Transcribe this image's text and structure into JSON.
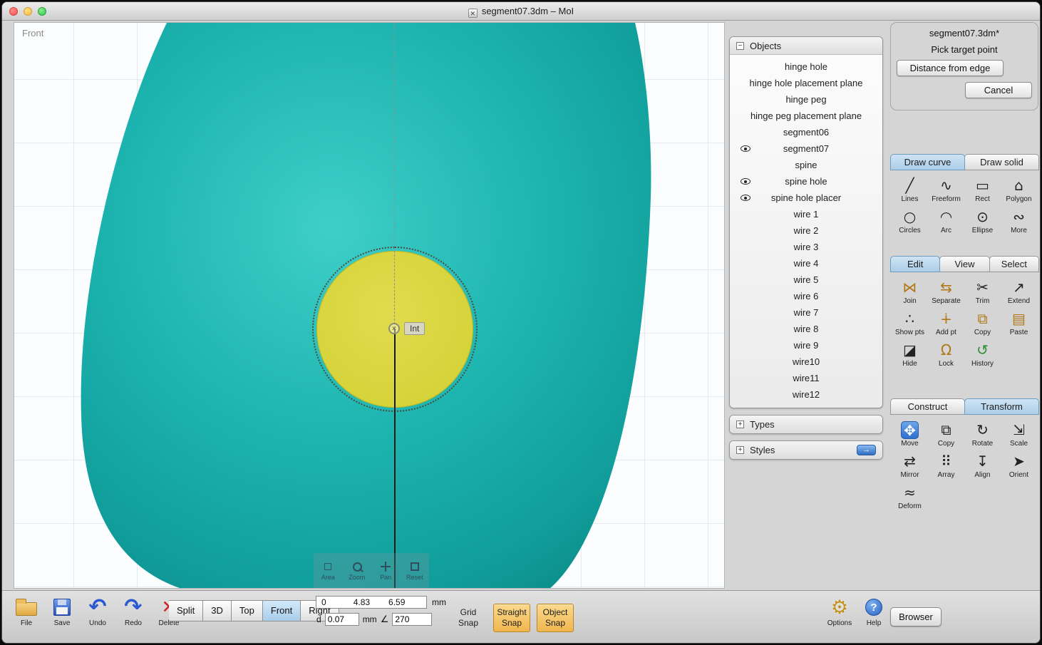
{
  "window": {
    "title": "segment07.3dm – MoI"
  },
  "viewport": {
    "view_label": "Front",
    "snap_tooltip": "Int",
    "object_color": "#1cb3ae",
    "selection_color": "#d5d13a",
    "controls": [
      {
        "name": "area-zoom-button",
        "label": "Area",
        "icon": "area-icon"
      },
      {
        "name": "zoom-button",
        "label": "Zoom",
        "icon": "zoom-icon"
      },
      {
        "name": "pan-button",
        "label": "Pan",
        "icon": "pan-icon"
      },
      {
        "name": "reset-view-button",
        "label": "Reset",
        "icon": "reset-icon"
      }
    ]
  },
  "scene": {
    "objects": {
      "title": "Objects",
      "collapse_symbol": "−",
      "items": [
        {
          "label": "hinge hole",
          "visible_eye": false
        },
        {
          "label": "hinge hole placement plane",
          "visible_eye": false
        },
        {
          "label": "hinge peg",
          "visible_eye": false
        },
        {
          "label": "hinge peg placement plane",
          "visible_eye": false
        },
        {
          "label": "segment06",
          "visible_eye": false
        },
        {
          "label": "segment07",
          "visible_eye": true
        },
        {
          "label": "spine",
          "visible_eye": false
        },
        {
          "label": "spine hole",
          "visible_eye": true
        },
        {
          "label": "spine hole placer",
          "visible_eye": true
        },
        {
          "label": "wire 1",
          "visible_eye": false
        },
        {
          "label": "wire 2",
          "visible_eye": false
        },
        {
          "label": "wire 3",
          "visible_eye": false
        },
        {
          "label": "wire 4",
          "visible_eye": false
        },
        {
          "label": "wire 5",
          "visible_eye": false
        },
        {
          "label": "wire 6",
          "visible_eye": false
        },
        {
          "label": "wire 7",
          "visible_eye": false
        },
        {
          "label": "wire 8",
          "visible_eye": false
        },
        {
          "label": "wire 9",
          "visible_eye": false
        },
        {
          "label": "wire10",
          "visible_eye": false
        },
        {
          "label": "wire11",
          "visible_eye": false
        },
        {
          "label": "wire12",
          "visible_eye": false
        }
      ]
    },
    "types": {
      "title": "Types",
      "collapse_symbol": "+"
    },
    "styles": {
      "title": "Styles",
      "collapse_symbol": "+"
    }
  },
  "command_panel": {
    "doc_title": "segment07.3dm*",
    "prompt": "Pick target point",
    "buttons": [
      {
        "label": "Distance from edge"
      },
      {
        "label": "Cancel"
      }
    ]
  },
  "draw_section": {
    "tabs": [
      {
        "name": "tab-draw-curve",
        "label": "Draw curve",
        "active": true
      },
      {
        "name": "tab-draw-solid",
        "label": "Draw solid",
        "active": false
      }
    ],
    "tools": [
      {
        "name": "tool-lines",
        "label": "Lines",
        "icon": "lines-icon",
        "glyph": "╱"
      },
      {
        "name": "tool-freeform",
        "label": "Freeform",
        "icon": "freeform-icon",
        "glyph": "∿"
      },
      {
        "name": "tool-rect",
        "label": "Rect",
        "icon": "rect-icon",
        "glyph": "▭"
      },
      {
        "name": "tool-polygon",
        "label": "Polygon",
        "icon": "polygon-icon",
        "glyph": "⌂"
      },
      {
        "name": "tool-circles",
        "label": "Circles",
        "icon": "circles-icon",
        "glyph": "○"
      },
      {
        "name": "tool-arc",
        "label": "Arc",
        "icon": "arc-icon",
        "glyph": "◠"
      },
      {
        "name": "tool-ellipse",
        "label": "Ellipse",
        "icon": "ellipse-icon",
        "glyph": "⊙"
      },
      {
        "name": "tool-more-curves",
        "label": "More",
        "icon": "more-curves-icon",
        "glyph": "∾"
      }
    ]
  },
  "edit_section": {
    "tabs": [
      {
        "name": "tab-edit",
        "label": "Edit",
        "active": true
      },
      {
        "name": "tab-view",
        "label": "View",
        "active": false
      },
      {
        "name": "tab-select",
        "label": "Select",
        "active": false
      }
    ],
    "tools": [
      {
        "name": "tool-join",
        "label": "Join",
        "icon": "join-icon",
        "glyph": "⋈",
        "color": "#b07818"
      },
      {
        "name": "tool-separate",
        "label": "Separate",
        "icon": "separate-icon",
        "glyph": "⇆",
        "color": "#b07818"
      },
      {
        "name": "tool-trim",
        "label": "Trim",
        "icon": "trim-icon",
        "glyph": "✂"
      },
      {
        "name": "tool-extend",
        "label": "Extend",
        "icon": "extend-icon",
        "glyph": "↗"
      },
      {
        "name": "tool-show-points",
        "label": "Show pts",
        "icon": "show-points-icon",
        "glyph": "∴"
      },
      {
        "name": "tool-add-point",
        "label": "Add pt",
        "icon": "add-point-icon",
        "glyph": "∔",
        "color": "#b07818"
      },
      {
        "name": "tool-copy",
        "label": "Copy",
        "icon": "copy-icon",
        "glyph": "⧉",
        "color": "#b07818"
      },
      {
        "name": "tool-paste",
        "label": "Paste",
        "icon": "paste-icon",
        "glyph": "▤",
        "color": "#b07818"
      },
      {
        "name": "tool-hide",
        "label": "Hide",
        "icon": "hide-icon",
        "glyph": "◪"
      },
      {
        "name": "tool-lock",
        "label": "Lock",
        "icon": "lock-icon",
        "glyph": "Ω",
        "color": "#b07818"
      },
      {
        "name": "tool-history",
        "label": "History",
        "icon": "history-icon",
        "glyph": "↺",
        "color": "#2d8f2d"
      }
    ]
  },
  "construct_section": {
    "tabs": [
      {
        "name": "tab-construct",
        "label": "Construct",
        "active": false
      },
      {
        "name": "tab-transform",
        "label": "Transform",
        "active": true
      }
    ],
    "tools": [
      {
        "name": "tool-move",
        "label": "Move",
        "icon": "move-icon",
        "glyph": "✥",
        "active": true
      },
      {
        "name": "tool-copy-transform",
        "label": "Copy",
        "icon": "copy-transform-icon",
        "glyph": "⧉"
      },
      {
        "name": "tool-rotate",
        "label": "Rotate",
        "icon": "rotate-icon",
        "glyph": "↻"
      },
      {
        "name": "tool-scale",
        "label": "Scale",
        "icon": "scale-icon",
        "glyph": "⇲"
      },
      {
        "name": "tool-mirror",
        "label": "Mirror",
        "icon": "mirror-icon",
        "glyph": "⇄"
      },
      {
        "name": "tool-array",
        "label": "Array",
        "icon": "array-icon",
        "glyph": "⠿"
      },
      {
        "name": "tool-align",
        "label": "Align",
        "icon": "align-icon",
        "glyph": "↧"
      },
      {
        "name": "tool-orient",
        "label": "Orient",
        "icon": "orient-icon",
        "glyph": "➤"
      },
      {
        "name": "tool-deform",
        "label": "Deform",
        "icon": "deform-icon",
        "glyph": "≈"
      }
    ]
  },
  "bottom_bar": {
    "file_tools": [
      {
        "name": "file-button",
        "label": "File",
        "icon": "folder-icon"
      },
      {
        "name": "save-button",
        "label": "Save",
        "icon": "save-icon"
      },
      {
        "name": "undo-button",
        "label": "Undo",
        "icon": "undo-icon"
      },
      {
        "name": "redo-button",
        "label": "Redo",
        "icon": "redo-icon"
      },
      {
        "name": "delete-button",
        "label": "Delete",
        "icon": "delete-icon"
      }
    ],
    "view_buttons": [
      {
        "name": "view-split-button",
        "label": "Split",
        "active": false
      },
      {
        "name": "view-3d-button",
        "label": "3D",
        "active": false
      },
      {
        "name": "view-top-button",
        "label": "Top",
        "active": false
      },
      {
        "name": "view-front-button",
        "label": "Front",
        "active": true
      },
      {
        "name": "view-right-button",
        "label": "Right",
        "active": false
      }
    ],
    "coords": {
      "x": "0",
      "y": "4.83",
      "z": "6.59",
      "unit": "mm",
      "d_label": "d",
      "d_value": "0.07",
      "d_unit": "mm",
      "angle_symbol": "∠",
      "angle_value": "270"
    },
    "snaps": [
      {
        "name": "grid-snap-toggle",
        "line1": "Grid",
        "line2": "Snap",
        "active": false
      },
      {
        "name": "straight-snap-toggle",
        "line1": "Straight",
        "line2": "Snap",
        "active": true
      },
      {
        "name": "object-snap-toggle",
        "line1": "Object",
        "line2": "Snap",
        "active": true
      }
    ],
    "right_tools": [
      {
        "name": "options-button",
        "label": "Options",
        "icon": "options-gear-icon"
      },
      {
        "name": "help-button",
        "label": "Help",
        "icon": "help-icon"
      }
    ],
    "browser_label": "Browser"
  }
}
